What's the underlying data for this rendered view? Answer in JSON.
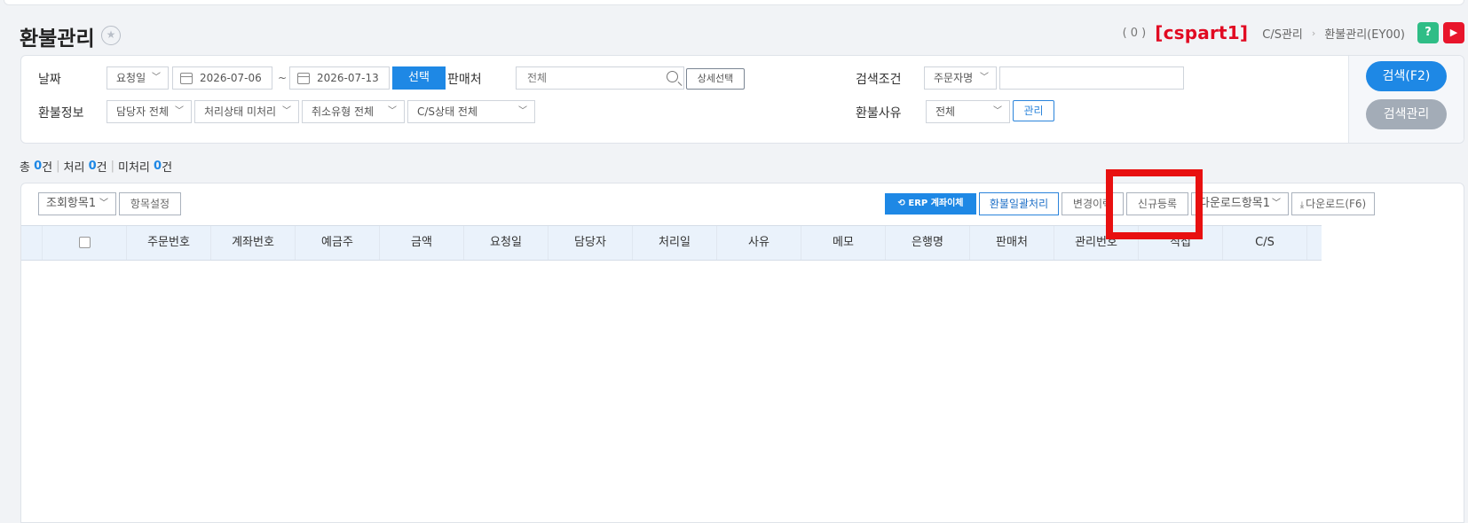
{
  "header": {
    "title": "환불관리",
    "count": "( 0 )",
    "user": "[cspart1]",
    "breadcrumb": [
      "C/S관리",
      "환불관리(EY00)"
    ],
    "help_label": "?",
    "youtube_label": "▶"
  },
  "filters": {
    "date_label": "날짜",
    "date_type": "요청일",
    "date_from": "2026-07-06",
    "date_sep": "~",
    "date_to": "2026-07-13",
    "select_btn": "선택",
    "seller_label": "판매처",
    "seller_value": "전체",
    "detail_btn": "상세선택",
    "cond_label": "검색조건",
    "cond_value": "주문자명",
    "cond_input": "",
    "refund_info_label": "환불정보",
    "manager": "담당자 전체",
    "status": "처리상태 미처리",
    "cancel_type": "취소유형 전체",
    "cs_status": "C/S상태 전체",
    "reason_label": "환불사유",
    "reason_value": "전체",
    "manage_btn": "관리",
    "search_btn": "검색(F2)",
    "search_manage_btn": "검색관리"
  },
  "summary": {
    "total_label": "총",
    "total": "0",
    "total_unit": "건",
    "done_label": "처리",
    "done": "0",
    "done_unit": "건",
    "undone_label": "미처리",
    "undone": "0",
    "undone_unit": "건"
  },
  "toolbar": {
    "view_items": "조회항목1",
    "item_settings": "항목설정",
    "erp_btn": "ERP 계좌이체",
    "bulk_btn": "환불일괄처리",
    "history_btn": "변경이력",
    "new_btn": "신규등록",
    "download_items": "다운로드항목1",
    "download_btn": "다운로드(F6)"
  },
  "table": {
    "columns": [
      "주문번호",
      "계좌번호",
      "예금주",
      "금액",
      "요청일",
      "담당자",
      "처리일",
      "사유",
      "메모",
      "은행명",
      "판매처",
      "관리번호",
      "직접",
      "C/S"
    ]
  },
  "colors": {
    "accent": "#1e88e5",
    "user": "#e10a22",
    "highlight": "#e81010"
  }
}
